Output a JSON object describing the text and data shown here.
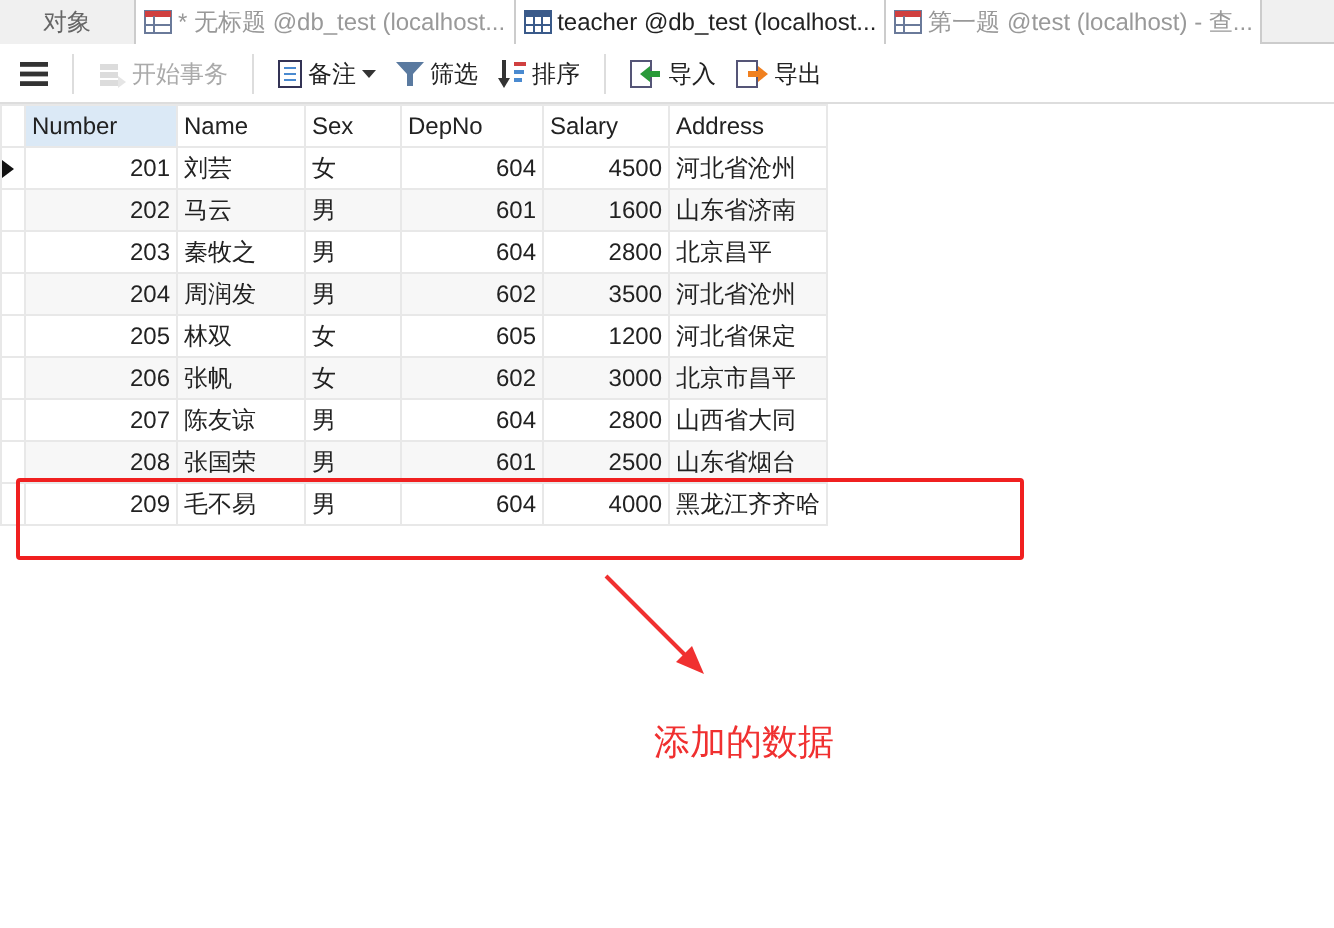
{
  "tabs": [
    {
      "label": "对象",
      "kind": "plain",
      "selected": false
    },
    {
      "label": "* 无标题 @db_test (localhost...",
      "kind": "query",
      "selected": false
    },
    {
      "label": "teacher @db_test (localhost...",
      "kind": "table",
      "selected": true
    },
    {
      "label": "第一题 @test (localhost) - 查...",
      "kind": "query",
      "selected": false
    }
  ],
  "toolbar": [
    {
      "kind": "menu",
      "disabled": false
    },
    {
      "kind": "transaction",
      "label": "开始事务",
      "disabled": true
    },
    {
      "kind": "memo",
      "label": "备注",
      "disabled": false
    },
    {
      "kind": "filter",
      "label": "筛选",
      "disabled": false
    },
    {
      "kind": "sort",
      "label": "排序",
      "disabled": false
    },
    {
      "kind": "import",
      "label": "导入",
      "disabled": false
    },
    {
      "kind": "export",
      "label": "导出",
      "disabled": false
    }
  ],
  "table": {
    "columns": [
      "Number",
      "Name",
      "Sex",
      "DepNo",
      "Salary",
      "Address"
    ],
    "rows": [
      {
        "cells": [
          "201",
          "刘芸",
          "女",
          "604",
          "4500",
          "河北省沧州"
        ],
        "selected": true
      },
      {
        "cells": [
          "202",
          "马云",
          "男",
          "601",
          "1600",
          "山东省济南"
        ],
        "selected": false
      },
      {
        "cells": [
          "203",
          "秦牧之",
          "男",
          "604",
          "2800",
          "北京昌平"
        ],
        "selected": false
      },
      {
        "cells": [
          "204",
          "周润发",
          "男",
          "602",
          "3500",
          "河北省沧州"
        ],
        "selected": false
      },
      {
        "cells": [
          "205",
          "林双",
          "女",
          "605",
          "1200",
          "河北省保定"
        ],
        "selected": false
      },
      {
        "cells": [
          "206",
          "张帆",
          "女",
          "602",
          "3000",
          "北京市昌平"
        ],
        "selected": false
      },
      {
        "cells": [
          "207",
          "陈友谅",
          "男",
          "604",
          "2800",
          "山西省大同"
        ],
        "selected": false
      },
      {
        "cells": [
          "208",
          "张国荣",
          "男",
          "601",
          "2500",
          "山东省烟台"
        ],
        "selected": false
      },
      {
        "cells": [
          "209",
          "毛不易",
          "男",
          "604",
          "4000",
          "黑龙江齐齐哈"
        ],
        "selected": false
      }
    ]
  },
  "annotation": {
    "text": "添加的数据"
  }
}
